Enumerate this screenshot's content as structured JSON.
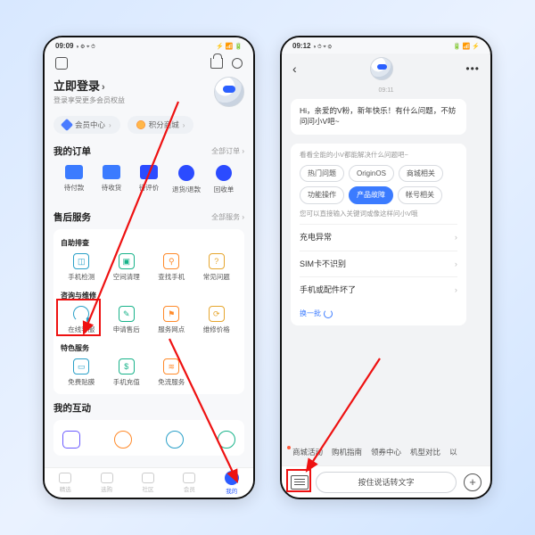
{
  "phone1": {
    "status": {
      "time": "09:09",
      "icons": "◑ ⚙ ⌖ ⏱",
      "right": "⚡ 📶 🔋"
    },
    "login": {
      "title": "立即登录",
      "sub": "登录享受更多会员权益"
    },
    "pills": {
      "member": "会员中心",
      "points": "积分商城"
    },
    "orders": {
      "title": "我的订单",
      "more": "全部订单 ›",
      "items": [
        "待付款",
        "待收货",
        "待评价",
        "退货/退款",
        "回收单"
      ]
    },
    "aftersale": {
      "title": "售后服务",
      "more": "全部服务 ›",
      "g1_label": "自助排查",
      "g1": [
        "手机检测",
        "空间清理",
        "查找手机",
        "常见问题"
      ],
      "g2_label": "咨询与维修",
      "g2": [
        "在线客服",
        "申请售后",
        "服务网点",
        "维修价格"
      ],
      "g3_label": "特色服务",
      "g3": [
        "免费贴膜",
        "手机充值",
        "免流服务"
      ]
    },
    "interact": {
      "title": "我的互动"
    },
    "nav": [
      "精选",
      "选购",
      "社区",
      "会员",
      "我的"
    ]
  },
  "phone2": {
    "status": {
      "time": "09:12",
      "icons": "◑ ⏱ ⌖ ⚙",
      "right": "🔋 📶 ⚡"
    },
    "ts": "09:11",
    "greeting": "Hi，亲爱的V粉，新年快乐！有什么问题，不妨问问小V吧~",
    "hint1": "看看全能的小V都能解决什么问题吧~",
    "chips": [
      "热门问题",
      "OriginOS",
      "商城相关",
      "功能操作",
      "产品故障",
      "帐号相关"
    ],
    "hint2": "您可以直接输入关键词或像这样问小V哦",
    "qs": [
      "充电异常",
      "SIM卡不识别",
      "手机或配件坏了"
    ],
    "refresh": "换一批",
    "suggestions": [
      "商城活动",
      "购机指南",
      "领券中心",
      "机型对比",
      "以"
    ],
    "voice": "按住说话转文字"
  }
}
